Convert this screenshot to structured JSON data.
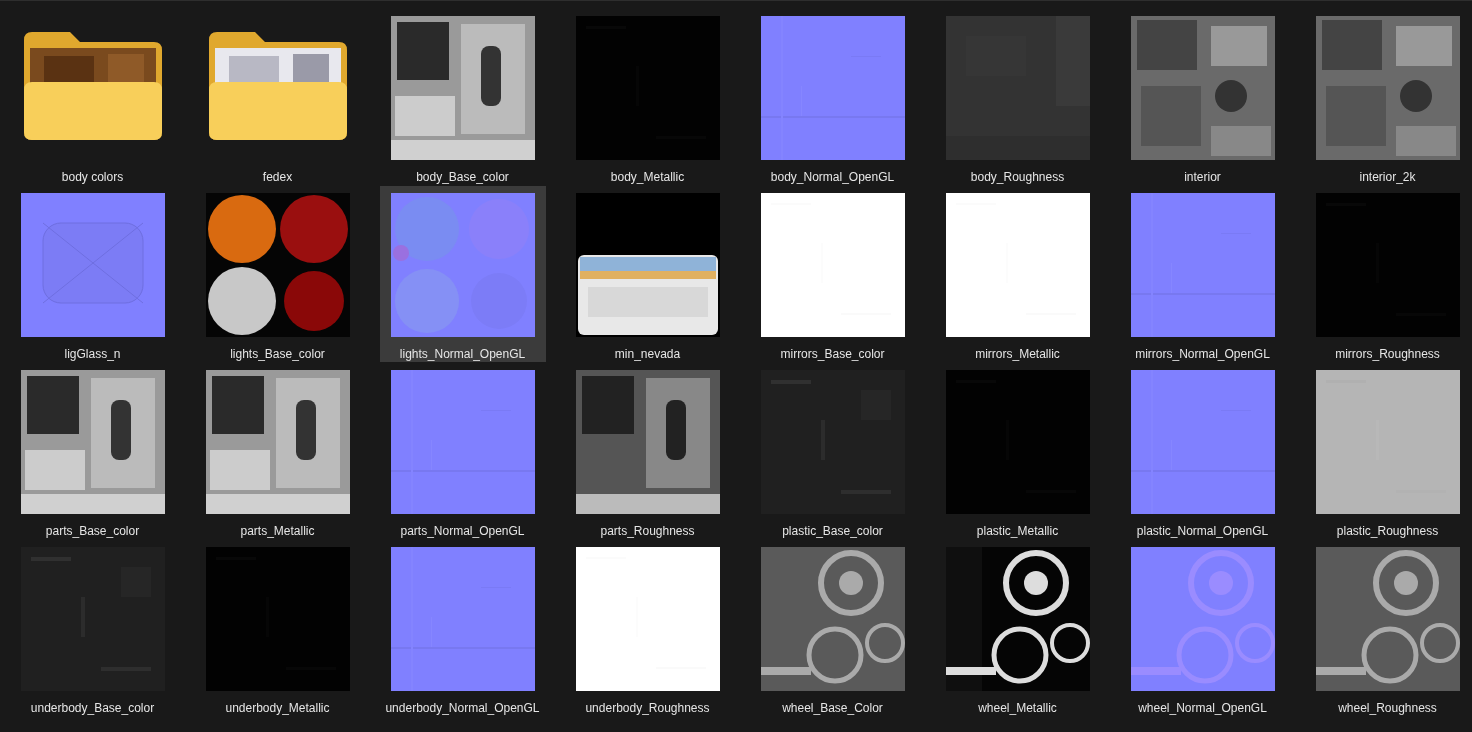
{
  "items": [
    {
      "name": "body colors",
      "kind": "folder",
      "selected": false
    },
    {
      "name": "fedex",
      "kind": "folder",
      "selected": false
    },
    {
      "name": "body_Base_color",
      "selected": false
    },
    {
      "name": "body_Metallic",
      "selected": false
    },
    {
      "name": "body_Normal_OpenGL",
      "selected": false
    },
    {
      "name": "body_Roughness",
      "selected": false
    },
    {
      "name": "interior",
      "selected": false
    },
    {
      "name": "interior_2k",
      "selected": false
    },
    {
      "name": "ligGlass_n",
      "selected": false
    },
    {
      "name": "lights_Base_color",
      "selected": false
    },
    {
      "name": "lights_Normal_OpenGL",
      "selected": true
    },
    {
      "name": "min_nevada",
      "selected": false
    },
    {
      "name": "mirrors_Base_color",
      "selected": false
    },
    {
      "name": "mirrors_Metallic",
      "selected": false
    },
    {
      "name": "mirrors_Normal_OpenGL",
      "selected": false
    },
    {
      "name": "mirrors_Roughness",
      "selected": false
    },
    {
      "name": "parts_Base_color",
      "selected": false
    },
    {
      "name": "parts_Metallic",
      "selected": false
    },
    {
      "name": "parts_Normal_OpenGL",
      "selected": false
    },
    {
      "name": "parts_Roughness",
      "selected": false
    },
    {
      "name": "plastic_Base_color",
      "selected": false
    },
    {
      "name": "plastic_Metallic",
      "selected": false
    },
    {
      "name": "plastic_Normal_OpenGL",
      "selected": false
    },
    {
      "name": "plastic_Roughness",
      "selected": false
    },
    {
      "name": "underbody_Base_color",
      "selected": false
    },
    {
      "name": "underbody_Metallic",
      "selected": false
    },
    {
      "name": "underbody_Normal_OpenGL",
      "selected": false
    },
    {
      "name": "underbody_Roughness",
      "selected": false
    },
    {
      "name": "wheel_Base_Color",
      "selected": false
    },
    {
      "name": "wheel_Metallic",
      "selected": false
    },
    {
      "name": "wheel_Normal_OpenGL",
      "selected": false
    },
    {
      "name": "wheel_Roughness",
      "selected": false
    }
  ]
}
